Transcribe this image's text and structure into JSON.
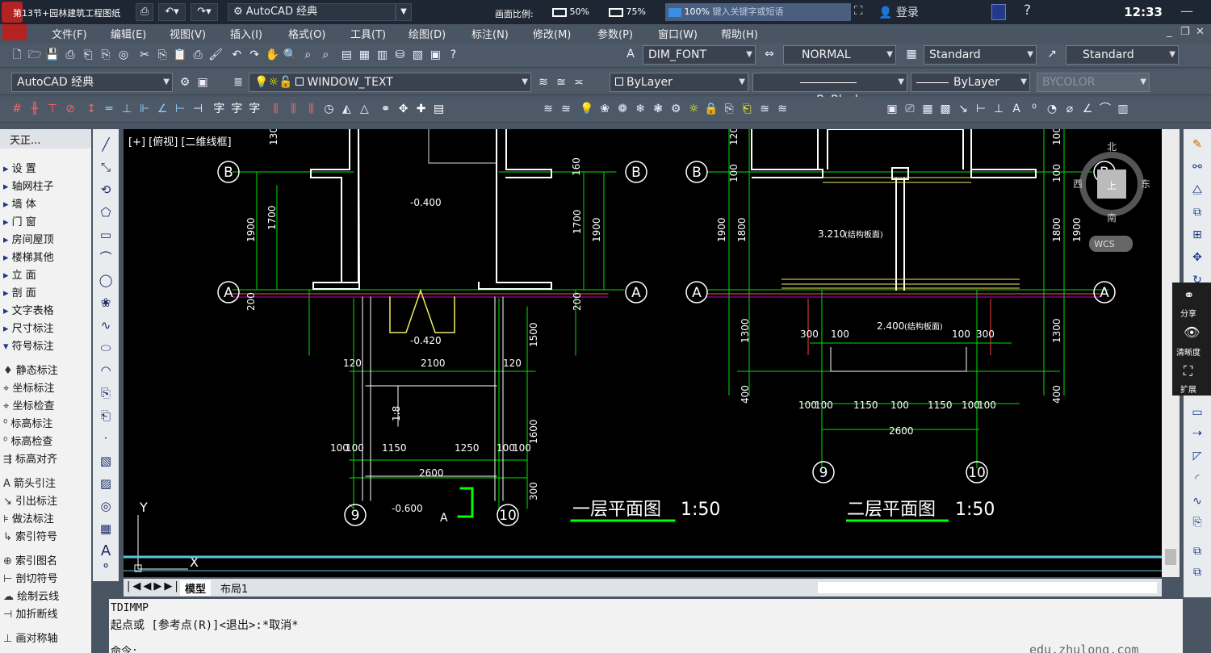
{
  "titlebar": {
    "caption": "第13节+园林建筑工程图纸",
    "app_name": "AutoCAD 经典",
    "scale_label": "画面比例:",
    "scale_options": [
      "50%",
      "75%",
      "100%"
    ],
    "search_placeholder": "键入关键字或短语",
    "login": "登录",
    "clock": "12:33"
  },
  "menus": [
    "文件(F)",
    "编辑(E)",
    "视图(V)",
    "插入(I)",
    "格式(O)",
    "工具(T)",
    "绘图(D)",
    "标注(N)",
    "修改(M)",
    "参数(P)",
    "窗口(W)",
    "帮助(H)"
  ],
  "toolbar2": {
    "dim_font": "DIM_FONT",
    "normal": "NORMAL",
    "standard1": "Standard",
    "standard2": "Standard"
  },
  "toolbar3": {
    "workspace": "AutoCAD 经典",
    "layer": "WINDOW_TEXT",
    "color": "ByLayer",
    "linetype": "ByBlock",
    "lineweight": "ByLayer",
    "plotstyle": "BYCOLOR"
  },
  "leftpanel": {
    "title": "天正...",
    "items": [
      "设  置",
      "轴网柱子",
      "墙  体",
      "门  窗",
      "房间屋顶",
      "楼梯其他",
      "立  面",
      "剖  面",
      "文字表格",
      "尺寸标注",
      "符号标注",
      "静态标注",
      "坐标标注",
      "坐标检查",
      "标高标注",
      "标高检查",
      "标高对齐",
      "箭头引注",
      "引出标注",
      "做法标注",
      "索引符号",
      "索引图名",
      "剖切符号",
      "绘制云线",
      "加折断线",
      "画对称轴"
    ]
  },
  "canvas": {
    "viewport_label": "[+] [俯视] [二维线框]",
    "compass": {
      "north": "北",
      "south": "南",
      "east": "东",
      "west": "西",
      "center": "上",
      "wcs": "WCS"
    },
    "left_plan": {
      "axes": [
        "B",
        "A",
        "9",
        "10"
      ],
      "elev1": "-0.400",
      "elev2": "-0.420",
      "elev3": "-0.600",
      "dims": [
        "1900",
        "1700",
        "200",
        "1700",
        "1900",
        "200",
        "120",
        "2100",
        "120",
        "1500",
        "100",
        "100",
        "1150",
        "1250",
        "100",
        "100",
        "2600",
        "1600",
        "1:8",
        "300",
        "160",
        "130"
      ],
      "title": "一层平面图",
      "scale": "1:50",
      "marker": "A"
    },
    "right_plan": {
      "axes": [
        "B",
        "A",
        "9",
        "10"
      ],
      "elev1": "3.210",
      "elev1_note": "(结构板面)",
      "elev2": "2.400",
      "elev2_note": "(结构板面)",
      "dims": [
        "1900",
        "1800",
        "100",
        "100",
        "1800",
        "1900",
        "1300",
        "300",
        "100",
        "100",
        "300",
        "1300",
        "400",
        "400",
        "100",
        "100",
        "1150",
        "100",
        "1150",
        "100",
        "100",
        "2600",
        "120",
        "100"
      ],
      "title": "二层平面图",
      "scale": "1:50"
    },
    "ucs_x": "X",
    "ucs_y": "Y"
  },
  "tabs": [
    "模型",
    "布局1"
  ],
  "share": {
    "share": "分享",
    "clarity": "清晰度",
    "expand": "扩展"
  },
  "command": {
    "line1": "TDIMMP",
    "line2": "起点或 [参考点(R)]<退出>:*取消*",
    "line3": "命令:"
  },
  "watermark": "edu.zhulong.com"
}
